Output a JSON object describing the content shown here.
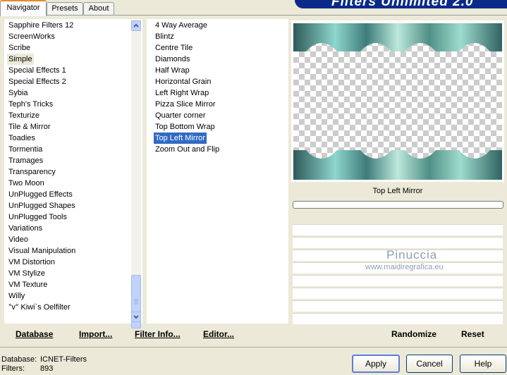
{
  "tabs": [
    "Navigator",
    "Presets",
    "About"
  ],
  "banner": {
    "title": "Filters Unlimited 2.0"
  },
  "categories": [
    "Sapphire Filters 12",
    "ScreenWorks",
    "Scribe",
    "Simple",
    "Special Effects 1",
    "Special Effects 2",
    "Sybia",
    "Teph's Tricks",
    "Texturize",
    "Tile & Mirror",
    "Toadies",
    "Tormentia",
    "Tramages",
    "Transparency",
    "Two Moon",
    "UnPlugged Effects",
    "UnPlugged Shapes",
    "UnPlugged Tools",
    "Variations",
    "Video",
    "Visual Manipulation",
    "VM Distortion",
    "VM Stylize",
    "VM Texture",
    "Willy",
    "°v° Kiwi`s Oelfilter"
  ],
  "selected_category": "Simple",
  "filters": [
    "4 Way Average",
    "Blintz",
    "Centre Tile",
    "Diamonds",
    "Half Wrap",
    "Horizontal Grain",
    "Left Right Wrap",
    "Pizza Slice Mirror",
    "Quarter corner",
    "Top Bottom Wrap",
    "Top Left Mirror",
    "Zoom Out and Flip"
  ],
  "selected_filter": "Top Left Mirror",
  "preview": {
    "filter_label": "Top Left Mirror"
  },
  "watermark": {
    "name": "Pinuccia",
    "url": "www.maidiregrafica.eu"
  },
  "bottom_actions": {
    "database": "Database",
    "import": "Import...",
    "filter_info": "Filter Info...",
    "editor": "Editor...",
    "randomize": "Randomize",
    "reset": "Reset"
  },
  "status": {
    "database_label": "Database:",
    "database_value": "ICNET-Filters",
    "filters_label": "Filters:",
    "filters_value": "893"
  },
  "buttons": {
    "apply": "Apply",
    "cancel": "Cancel",
    "help": "Help"
  },
  "colors": {
    "selection": "#316ac5",
    "banner": "#0a2a8a",
    "tab_highlight": "#e68b2c"
  },
  "icons": {
    "scroll_up": "chevron-up-icon",
    "scroll_down": "chevron-down-icon"
  }
}
